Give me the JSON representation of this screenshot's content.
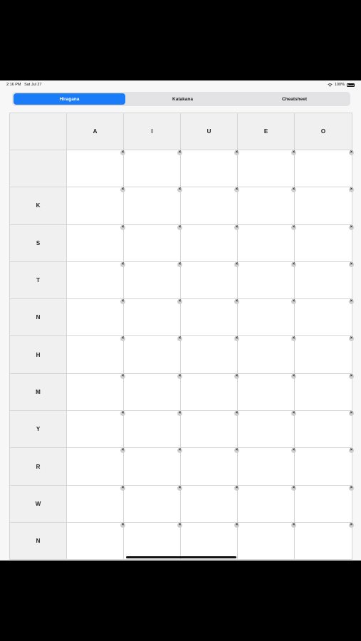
{
  "status": {
    "time": "2:16 PM",
    "date": "Sat Jul 27",
    "battery": "100%"
  },
  "tabs": [
    {
      "label": "Hiragana",
      "active": true
    },
    {
      "label": "Katakana",
      "active": false
    },
    {
      "label": "Cheatsheet",
      "active": false
    }
  ],
  "columns": [
    "A",
    "I",
    "U",
    "E",
    "O"
  ],
  "rows": [
    "",
    "K",
    "S",
    "T",
    "N",
    "H",
    "M",
    "Y",
    "R",
    "W",
    "N"
  ],
  "clear_symbol": "×",
  "colors": {
    "accent": "#1a7cf9"
  }
}
